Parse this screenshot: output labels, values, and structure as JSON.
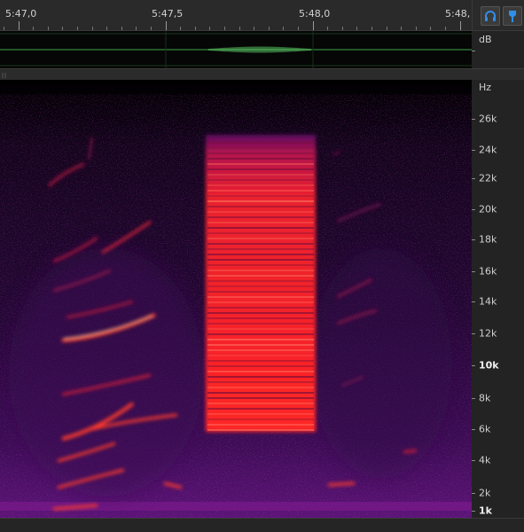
{
  "timeline": {
    "labels": [
      "5:47,0",
      "5:47,5",
      "5:48,0",
      "5:48,"
    ]
  },
  "toolbar": {
    "monitor_icon": "headphones-icon",
    "marker_icon": "marker-pin-icon",
    "accent_color": "#2f8fe8"
  },
  "waveform": {
    "unit_label": "dB",
    "line_color": "#3ea84a"
  },
  "spectrogram": {
    "unit_label": "Hz",
    "frequency_labels": [
      "26k",
      "24k",
      "22k",
      "20k",
      "18k",
      "16k",
      "14k",
      "12k",
      "10k",
      "8k",
      "6k",
      "4k",
      "2k",
      "1k"
    ],
    "palette": [
      "#000000",
      "#2a0638",
      "#6a0f77",
      "#b0134f",
      "#ff2c2c",
      "#ff9a7a"
    ]
  }
}
